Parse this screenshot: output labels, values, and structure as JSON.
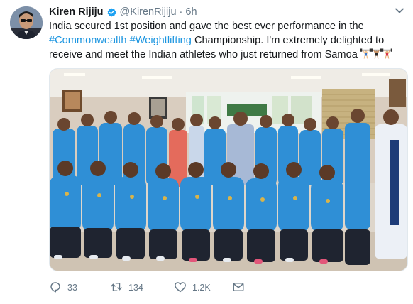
{
  "tweet": {
    "author_name": "Kiren Rijiju",
    "author_handle": "@KirenRijiju",
    "separator": "·",
    "timestamp": "6h",
    "text": {
      "part1": "India secured 1st position and gave the best ever performance in the",
      "hashtag1": "#Commonwealth",
      "space": " ",
      "hashtag2": "#Weightlifting",
      "part2": " Championship. I'm extremely delighted to receive and meet the Indian athletes who just returned from Samoa"
    },
    "emojis": [
      "weightlifter-emoji",
      "weightlifter-emoji",
      "weightlifter-emoji"
    ],
    "stats": {
      "replies": "33",
      "retweets": "134",
      "likes": "1.2K"
    }
  },
  "icons": {
    "verified": "verified-badge-icon",
    "more": "chevron-down-icon",
    "reply": "reply-icon",
    "retweet": "retweet-icon",
    "like": "heart-icon",
    "dm": "envelope-icon"
  },
  "colors": {
    "link": "#1b95e0",
    "secondary_text": "#657786",
    "verified_badge": "#1da1f2",
    "jersey_blue": "#2f8fd6"
  }
}
